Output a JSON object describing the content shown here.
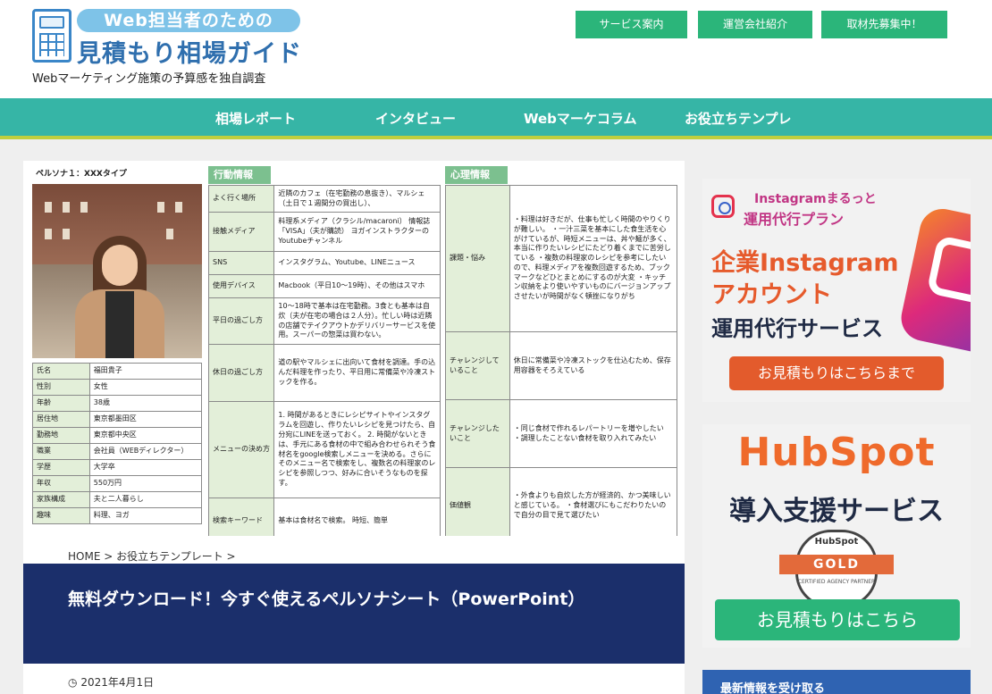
{
  "header": {
    "logo_top": "Web担当者のための",
    "logo_main": "見積もり相場ガイド",
    "tagline": "Webマーケティング施策の予算感を独自調査",
    "buttons": [
      "サービス案内",
      "運営会社紹介",
      "取材先募集中！"
    ]
  },
  "nav": {
    "items": [
      "相場レポート",
      "インタビュー",
      "Webマーケコラム",
      "お役立ちテンプレ"
    ]
  },
  "persona": {
    "title": "ペルソナ１：XXXタイプ",
    "profile": [
      [
        "氏名",
        "福田貴子"
      ],
      [
        "性別",
        "女性"
      ],
      [
        "年齢",
        "38歳"
      ],
      [
        "居住地",
        "東京都墨田区"
      ],
      [
        "勤務地",
        "東京都中央区"
      ],
      [
        "職業",
        "会社員（WEBディレクター）"
      ],
      [
        "学歴",
        "大学卒"
      ],
      [
        "年収",
        "550万円"
      ],
      [
        "家族構成",
        "夫と二人暮らし"
      ],
      [
        "趣味",
        "料理、ヨガ"
      ]
    ],
    "action_head": "行動情報",
    "action": [
      [
        "よく行く場所",
        "近隣のカフェ（在宅勤務の息抜き）、マルシェ（土日で１週間分の買出し）、"
      ],
      [
        "接触メディア",
        "料理系メディア（クラシル/macaroni） 情報誌「VISA」（夫が購読） ヨガインストラクターのYoutubeチャンネル"
      ],
      [
        "SNS",
        "インスタグラム、Youtube、LINEニュース"
      ],
      [
        "使用デバイス",
        "Macbook（平日10〜19時）、その他はスマホ"
      ],
      [
        "平日の過ごし方",
        "10〜18時で基本は在宅勤務。3食とも基本は自炊（夫が在宅の場合は２人分）。忙しい時は近隣の店舗でテイクアウトかデリバリーサービスを使用。スーパーの惣菜は買わない。"
      ],
      [
        "休日の過ごし方",
        "道の駅やマルシェに出向いて食材を調達。手の込んだ料理を作ったり、平日用に常備菜や冷凍ストックを作る。"
      ],
      [
        "メニューの決め方",
        "1. 時間があるときにレシピサイトやインスタグラムを回遊し、作りたいレシピを見つけたら、自分宛にLINEを送っておく。 2. 時間がないときは、手元にある食材の中で組み合わせられそう食材名をgoogle検索しメニューを決める。さらにそのメニュー名で検索をし、複数名の料理家のレシピを参照しつつ、好みに合いそうなものを探す。"
      ],
      [
        "検索キーワード",
        "基本は食材名で検索。 時短、簡単"
      ]
    ],
    "psych_head": "心理情報",
    "psych": [
      [
        "課題・悩み",
        "・料理は好きだが、仕事も忙しく時間のやりくりが難しい。 ・一汁三菜を基本にした食生活を心がけているが、時短メニューは、丼や麺が多く、本当に作りたいレシピにたどり着くまでに苦労している ・複数の料理家のレシピを参考にしたいので、料理メディアを複数回遊するため、ブックマークなどひとまとめにするのが大変 ・キッチン収納をより使いやすいものにバージョンアップさせたいが時間がなく頓挫になりがち"
      ],
      [
        "チャレンジしていること",
        "休日に常備菜や冷凍ストックを仕込むため、保存用容器をそろえている"
      ],
      [
        "チャレンジしたいこと",
        "・同じ食材で作れるレパートリーを増やしたい ・調理したことない食材を取り入れてみたい"
      ],
      [
        "価値観",
        "・外食よりも自炊した方が経済的、かつ美味しいと感じている。 ・食材選びにもこだわりたいので自分の目で見て選びたい"
      ]
    ]
  },
  "article": {
    "breadcrumb": "HOME > お役立ちテンプレート >",
    "title": "無料ダウンロード！今すぐ使えるペルソナシート（PowerPoint）",
    "date": "2021年4月1日"
  },
  "sidebar": {
    "ad1": {
      "sub1": "Instagramまるっと",
      "sub2": "運用代行プラン",
      "line1": "企業Instagram",
      "line2": "アカウント",
      "line3": "運用代行サービス",
      "button": "お見積もりはこちらまで"
    },
    "ad2": {
      "line1": "HubSpot",
      "line2": "導入支援サービス",
      "badge_brand": "HubSpot",
      "badge_level": "GOLD",
      "badge_cert": "CERTIFIED AGENCY PARTNER",
      "button": "お見積もりはこちら"
    },
    "news_head": "最新情報を受け取る"
  },
  "colors": {
    "nav": "#36b5a6",
    "accent_green": "#2bb57a",
    "title_band": "#1b2f6b",
    "orange": "#e35b2c"
  }
}
